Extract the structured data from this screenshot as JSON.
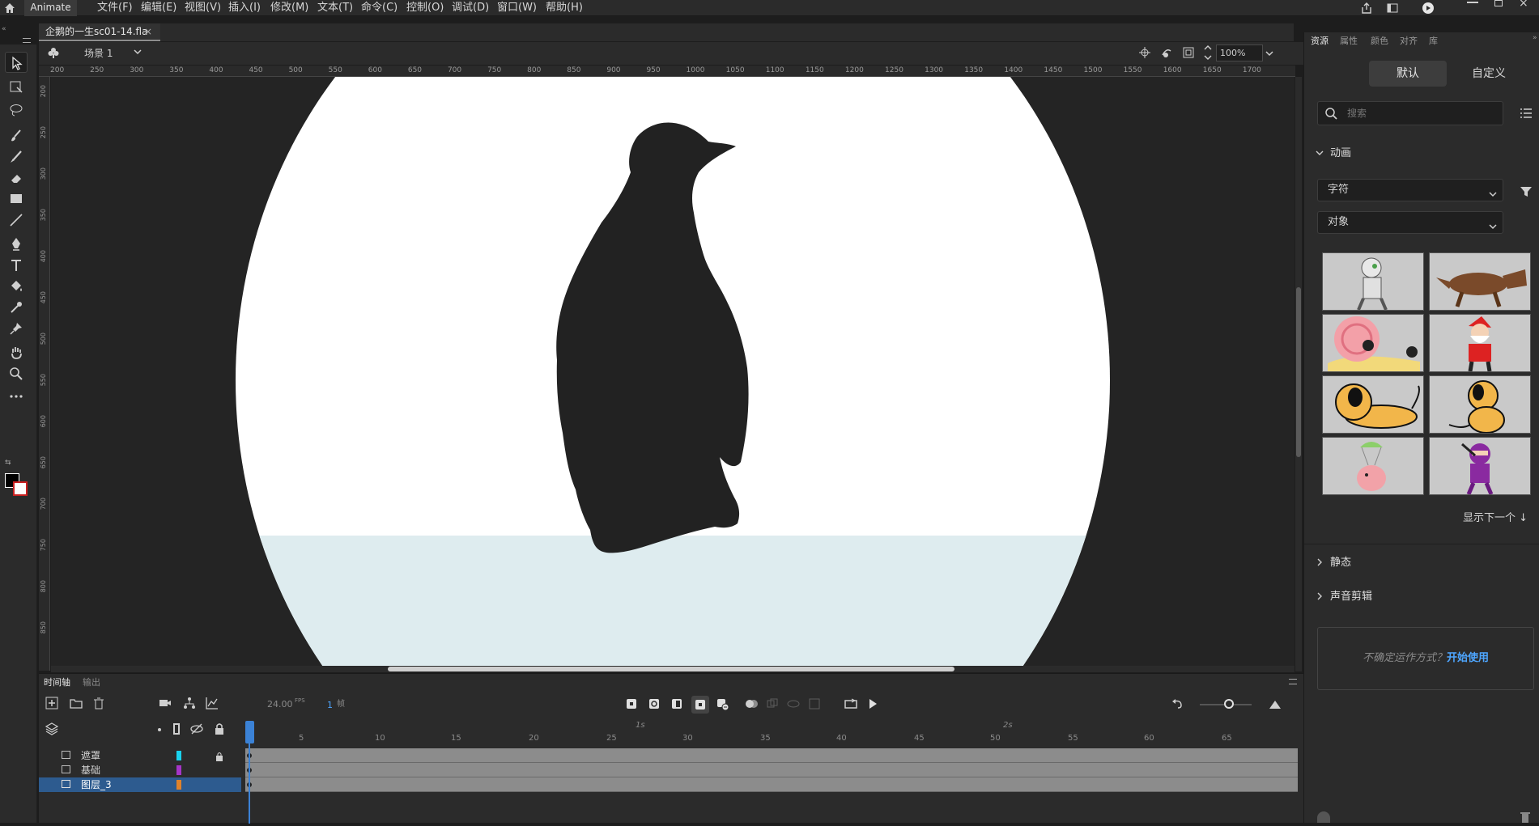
{
  "menubar": {
    "app_name": "Animate",
    "items": [
      "文件(F)",
      "编辑(E)",
      "视图(V)",
      "插入(I)",
      "修改(M)",
      "文本(T)",
      "命令(C)",
      "控制(O)",
      "调试(D)",
      "窗口(W)",
      "帮助(H)"
    ]
  },
  "document": {
    "tab_title": "企鹅的一生sc01-14.fla",
    "close": "×"
  },
  "scene": {
    "label": "场景 1",
    "zoom": "100%"
  },
  "ruler": {
    "h_ticks": [
      "200",
      "250",
      "300",
      "350",
      "400",
      "450",
      "500",
      "550",
      "600",
      "650",
      "700",
      "750",
      "800",
      "850",
      "900",
      "950",
      "1000",
      "1050",
      "1100",
      "1150",
      "1200",
      "1250",
      "1300",
      "1350",
      "1400",
      "1450",
      "1500",
      "1550",
      "1600",
      "1650",
      "1700"
    ],
    "v_ticks": [
      "200",
      "250",
      "300",
      "350",
      "400",
      "450",
      "500",
      "550",
      "600",
      "650",
      "700",
      "750",
      "800",
      "850"
    ]
  },
  "right_panel": {
    "tabs": [
      "资源",
      "属性",
      "颜色",
      "对齐",
      "库"
    ],
    "toggle": {
      "default": "默认",
      "custom": "自定义"
    },
    "search_placeholder": "搜索",
    "section_animation": "动画",
    "dropdown1": "字符",
    "dropdown2": "对象",
    "show_next": "显示下一个",
    "section_static": "静态",
    "section_sound": "声音剪辑",
    "help_text": "不确定运作方式？",
    "help_link": "开始使用"
  },
  "timeline": {
    "tabs": [
      "时间轴",
      "输出"
    ],
    "fps": "24.00",
    "fps_unit": "FPS",
    "frame": "1",
    "frame_unit": "帧",
    "ruler_numbers": [
      "5",
      "10",
      "15",
      "20",
      "25",
      "30",
      "35",
      "40",
      "45",
      "50",
      "55",
      "60",
      "65"
    ],
    "second_marks": [
      "1s",
      "2s"
    ],
    "layers": [
      {
        "name": "遮罩",
        "color": "#19d2ee"
      },
      {
        "name": "基础",
        "color": "#a535c8"
      },
      {
        "name": "图层_3",
        "color": "#e0822a"
      }
    ]
  },
  "colors": {
    "stage_bg": "#ffffff",
    "ground": "#deecef",
    "silhouette": "#222222",
    "accent": "#2d5b8f"
  }
}
